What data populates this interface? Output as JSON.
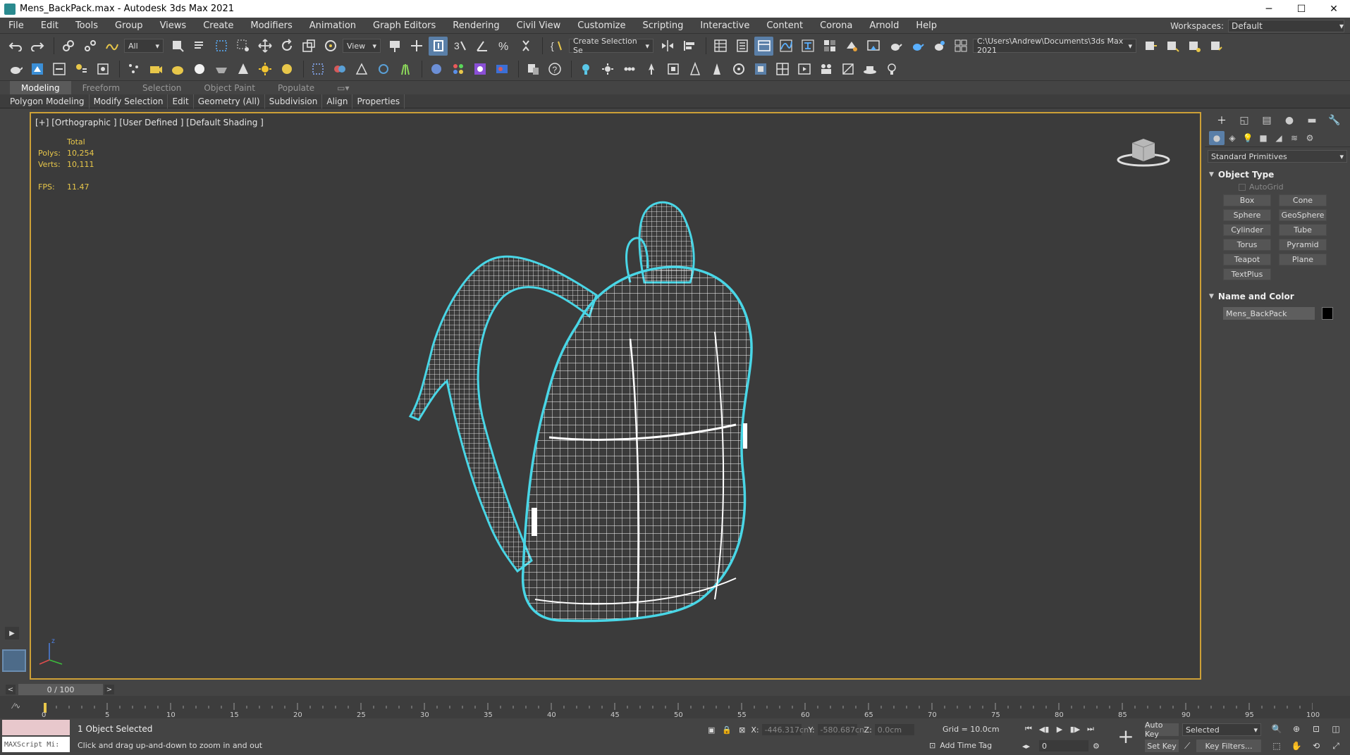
{
  "window": {
    "title": "Mens_BackPack.max - Autodesk 3ds Max 2021",
    "minimize": "─",
    "maximize": "☐",
    "close": "✕"
  },
  "menu": [
    "File",
    "Edit",
    "Tools",
    "Group",
    "Views",
    "Create",
    "Modifiers",
    "Animation",
    "Graph Editors",
    "Rendering",
    "Civil View",
    "Customize",
    "Scripting",
    "Interactive",
    "Content",
    "Corona",
    "Arnold",
    "Help"
  ],
  "workspace": {
    "label": "Workspaces:",
    "value": "Default"
  },
  "toolbar": {
    "filter_value": "All",
    "refcoord_value": "View",
    "named_selection": "Create Selection Se",
    "project_path": "C:\\Users\\Andrew\\Documents\\3ds Max 2021"
  },
  "ribbon": {
    "tabs": [
      "Modeling",
      "Freeform",
      "Selection",
      "Object Paint",
      "Populate"
    ],
    "active_tab": "Modeling",
    "sub": [
      "Polygon Modeling",
      "Modify Selection",
      "Edit",
      "Geometry (All)",
      "Subdivision",
      "Align",
      "Properties"
    ]
  },
  "viewport": {
    "label": "[+] [Orthographic ] [User Defined ] [Default Shading ]",
    "stats": {
      "total_label": "Total",
      "polys_label": "Polys:",
      "polys": "10,254",
      "verts_label": "Verts:",
      "verts": "10,111",
      "fps_label": "FPS:",
      "fps": "11.47"
    },
    "viewcube_label": "ViewCube",
    "axis_z": "z"
  },
  "command_panel": {
    "category": "Standard Primitives",
    "object_type_title": "Object Type",
    "autogrid_label": "AutoGrid",
    "primitives": [
      "Box",
      "Cone",
      "Sphere",
      "GeoSphere",
      "Cylinder",
      "Tube",
      "Torus",
      "Pyramid",
      "Teapot",
      "Plane",
      "TextPlus"
    ],
    "name_color_title": "Name and Color",
    "object_name": "Mens_BackPack",
    "object_color": "#000000"
  },
  "timeline": {
    "slider_value": "0 / 100",
    "prev": "<",
    "next": ">",
    "ticks": [
      "0",
      "5",
      "10",
      "15",
      "20",
      "25",
      "30",
      "35",
      "40",
      "45",
      "50",
      "55",
      "60",
      "65",
      "70",
      "75",
      "80",
      "85",
      "90",
      "95",
      "100"
    ]
  },
  "status": {
    "maxscript_label": "MAXScript Mi:",
    "selection": "1 Object Selected",
    "prompt": "Click and drag up-and-down to zoom in and out",
    "x_label": "X:",
    "x_value": "-446.317cn",
    "y_label": "Y:",
    "y_value": "-580.687cn",
    "z_label": "Z:",
    "z_value": "0.0cm",
    "grid": "Grid = 10.0cm",
    "add_time_tag": "Add Time Tag",
    "frame": "0",
    "auto_key": "Auto Key",
    "set_key": "Set Key",
    "key_mode": "Selected",
    "key_filters": "Key Filters..."
  },
  "colors": {
    "accent": "#5a7fa8",
    "viewport_border": "#cda037",
    "stats_text": "#e8c74a",
    "selection_outline": "#49d6e6",
    "wire": "#ffffff"
  }
}
